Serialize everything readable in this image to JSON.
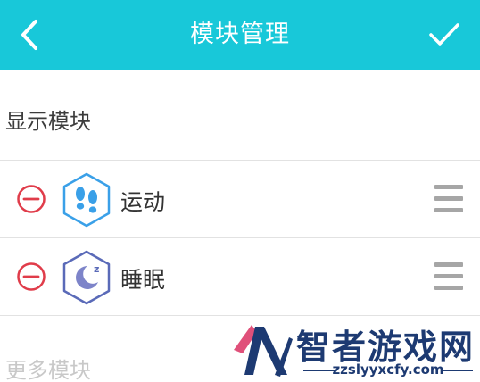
{
  "header": {
    "title": "模块管理",
    "back_icon": "chevron-left-icon",
    "confirm_icon": "checkmark-icon",
    "background_color": "#18c8d9"
  },
  "sections": {
    "shown_label": "显示模块",
    "more_label": "更多模块"
  },
  "modules": [
    {
      "label": "运动",
      "icon": "footprints-icon",
      "icon_color": "#3aa0e8",
      "remove_icon": "minus-circle-icon",
      "handle_icon": "drag-handle-icon"
    },
    {
      "label": "睡眠",
      "icon": "moon-sleep-icon",
      "icon_color": "#5a6ab8",
      "remove_icon": "minus-circle-icon",
      "handle_icon": "drag-handle-icon"
    }
  ],
  "watermark": {
    "name": "智者游戏网",
    "url": "zzslyyxcfy.com"
  },
  "colors": {
    "remove": "#e03c4a",
    "divider": "#e2e2e2",
    "handle": "#a6a6a6"
  }
}
